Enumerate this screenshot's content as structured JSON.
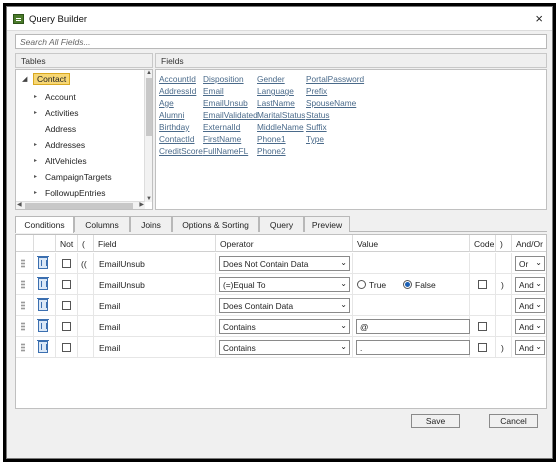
{
  "window": {
    "title": "Query Builder",
    "close": "×"
  },
  "search": {
    "placeholder": "Search All Fields..."
  },
  "tables": {
    "header": "Tables",
    "root": "Contact",
    "items": [
      "Account",
      "Activities",
      "Address",
      "Addresses",
      "AltVehicles",
      "CampaignTargets",
      "FollowupEntries"
    ]
  },
  "fields": {
    "header": "Fields",
    "columns": [
      [
        "AccountId",
        "AddressId",
        "Age",
        "Alumni",
        "Birthday",
        "ContactId",
        "CreditScore"
      ],
      [
        "Disposition",
        "Email",
        "EmailUnsub",
        "EmailValidated",
        "ExternalId",
        "FirstName",
        "FullNameFL"
      ],
      [
        "Gender",
        "Language",
        "LastName",
        "MaritalStatus",
        "MiddleName",
        "Phone1",
        "Phone2"
      ],
      [
        "PortalPassword",
        "Prefix",
        "SpouseName",
        "Status",
        "Suffix",
        "Type"
      ]
    ]
  },
  "tabs": [
    "Conditions",
    "Columns",
    "Joins",
    "Options & Sorting",
    "Query",
    "Preview"
  ],
  "grid": {
    "headers": {
      "not": "Not",
      "open": "(",
      "field": "Field",
      "operator": "Operator",
      "value": "Value",
      "code": "Code",
      "close": ")",
      "andor": "And/Or"
    },
    "rows": [
      {
        "open": "((",
        "field": "EmailUnsub",
        "operator": "Does Not Contain Data",
        "value": "",
        "close": "",
        "andor": "Or"
      },
      {
        "open": "",
        "field": "EmailUnsub",
        "operator": "(=)Equal To",
        "value": "",
        "true_label": "True",
        "false_label": "False",
        "close": ")",
        "andor": "And"
      },
      {
        "open": "",
        "field": "Email",
        "operator": "Does Contain Data",
        "value": "",
        "close": "",
        "andor": "And"
      },
      {
        "open": "",
        "field": "Email",
        "operator": "Contains",
        "value": "@",
        "close": "",
        "andor": "And"
      },
      {
        "open": "",
        "field": "Email",
        "operator": "Contains",
        "value": ".",
        "close": ")",
        "andor": "And"
      }
    ]
  },
  "buttons": {
    "save": "Save",
    "cancel": "Cancel"
  }
}
